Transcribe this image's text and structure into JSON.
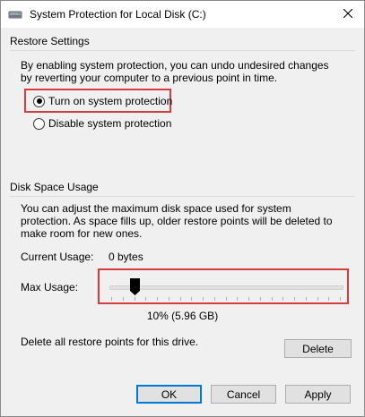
{
  "window": {
    "title": "System Protection for Local Disk (C:)"
  },
  "restore": {
    "group_label": "Restore Settings",
    "description": "By enabling system protection, you can undo undesired changes by reverting your computer to a previous point in time.",
    "options": [
      {
        "label": "Turn on system protection",
        "selected": true
      },
      {
        "label": "Disable system protection",
        "selected": false
      }
    ]
  },
  "disk": {
    "group_label": "Disk Space Usage",
    "description": "You can adjust the maximum disk space used for system protection. As space fills up, older restore points will be deleted to make room for new ones.",
    "current_usage_label": "Current Usage:",
    "current_usage_value": "0 bytes",
    "max_usage_label": "Max Usage:",
    "max_usage_value": "10% (5.96 GB)",
    "max_usage_percent": 10
  },
  "delete": {
    "text": "Delete all restore points for this drive.",
    "button_label": "Delete"
  },
  "buttons": {
    "ok": "OK",
    "cancel": "Cancel",
    "apply": "Apply"
  },
  "colors": {
    "highlight": "#d83b3b",
    "accent": "#0078d7"
  }
}
